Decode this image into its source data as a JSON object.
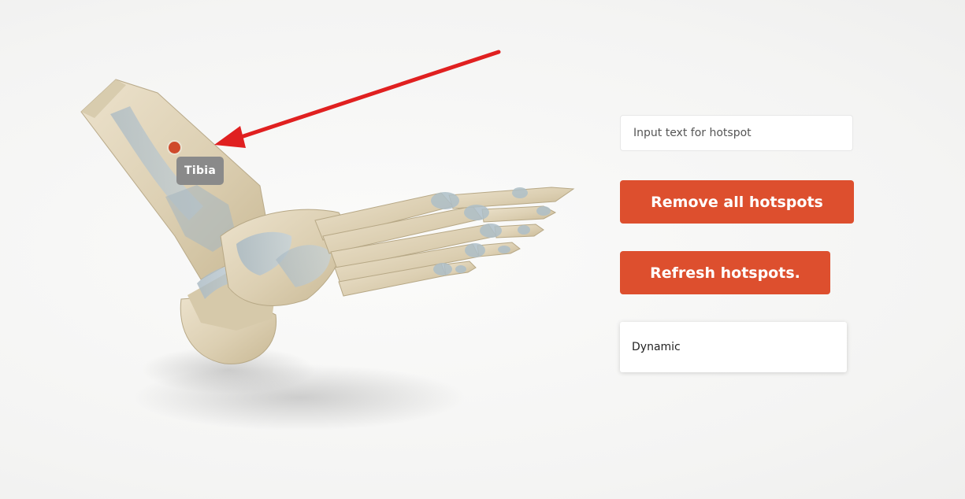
{
  "viewer": {
    "model_description": "foot skeleton 3D model",
    "hotspot": {
      "label": "Tibia",
      "dot_color": "#cf4a2c"
    },
    "annotation_arrow_color": "#e02020"
  },
  "panel": {
    "input": {
      "placeholder": "Input text for hotspot",
      "value": ""
    },
    "remove_button_label": "Remove all hotspots",
    "refresh_button_label": "Refresh hotspots.",
    "mode_select": {
      "selected": "Dynamic"
    }
  },
  "colors": {
    "accent": "#dd4f2e",
    "background": "#f6f6f5",
    "label_bg": "#8a8a8a"
  }
}
